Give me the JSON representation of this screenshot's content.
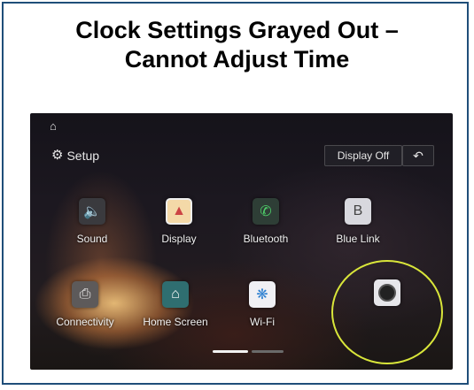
{
  "title": {
    "line1": "Clock Settings Grayed Out –",
    "line2": "Cannot Adjust Time"
  },
  "screen": {
    "header": {
      "home_icon": "home-icon",
      "setup_label": "Setup",
      "display_off_label": "Display Off",
      "back_icon": "back-arrow-icon"
    },
    "apps": [
      {
        "label": "Sound",
        "icon": "speaker-icon"
      },
      {
        "label": "Display",
        "icon": "display-icon"
      },
      {
        "label": "Bluetooth",
        "icon": "bluetooth-phone-icon"
      },
      {
        "label": "Blue Link",
        "icon": "blue-link-icon"
      },
      {
        "label": "Connectivity",
        "icon": "connectivity-icon"
      },
      {
        "label": "Home Screen",
        "icon": "home-screen-icon"
      },
      {
        "label": "Wi-Fi",
        "icon": "wifi-icon"
      },
      {
        "label": "",
        "icon": "clock-icon"
      }
    ],
    "highlight_color": "#d9e63a",
    "pager": {
      "pages": 2,
      "active": 1
    }
  }
}
